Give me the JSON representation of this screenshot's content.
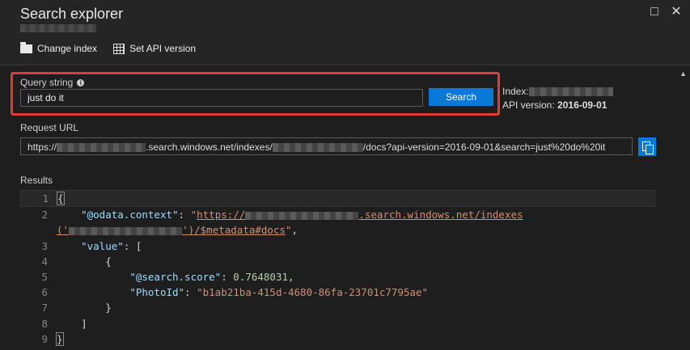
{
  "window": {
    "title": "Search explorer",
    "controls": [
      "maximize-icon",
      "close-icon"
    ]
  },
  "toolbar": {
    "change_index": "Change index",
    "set_api_version": "Set API version"
  },
  "query": {
    "label": "Query string",
    "value": "just do it",
    "search_button": "Search"
  },
  "meta": {
    "index_label": "Index:",
    "api_label": "API version:",
    "api_value": "2016-09-01"
  },
  "request": {
    "label": "Request URL",
    "url_prefix": "https://",
    "url_mid": ".search.windows.net/indexes/",
    "url_suffix": "/docs?api-version=2016-09-01&search=just%20do%20it"
  },
  "results": {
    "label": "Results",
    "line_numbers": [
      "1",
      "2",
      "3",
      "4",
      "5",
      "6",
      "7",
      "8",
      "9"
    ],
    "json": {
      "context_key": "\"@odata.context\"",
      "context_url_a": "https://",
      "context_url_b": ".search.windows.net/indexes",
      "context_url_c": "('",
      "context_url_d": "')/$metadata#docs",
      "value_key": "\"value\"",
      "score_key": "\"@search.score\"",
      "score_value": "0.7648031",
      "photo_key": "\"PhotoId\"",
      "photo_value": "\"b1ab21ba-415d-4680-86fa-23701c7795ae\""
    }
  }
}
